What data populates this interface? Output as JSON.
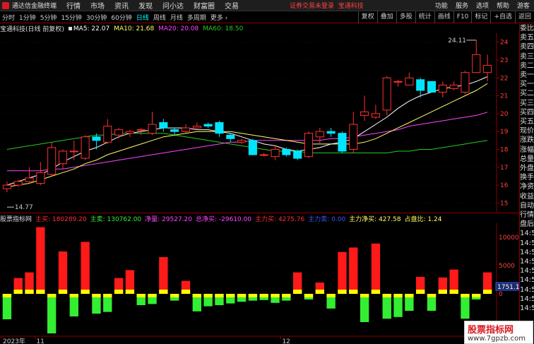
{
  "menu": {
    "app_title": "通达信金融终端",
    "items": [
      "行情",
      "市场",
      "资讯",
      "发现",
      "问小达",
      "财富圈",
      "交易"
    ],
    "notice": "证券交易未登录",
    "stock_name_top": "宝通科技",
    "right_items": [
      "功能",
      "服务",
      "选项",
      "帮助",
      "游客"
    ]
  },
  "toolbar": {
    "periods": [
      "分时",
      "1分钟",
      "5分钟",
      "15分钟",
      "30分钟",
      "60分钟",
      "日线",
      "周线",
      "月线",
      "多周期",
      "更多"
    ],
    "active": "日线",
    "right": [
      "复权",
      "叠加",
      "多股",
      "统计",
      "画线",
      "F10",
      "标记",
      "+自选",
      "返回"
    ]
  },
  "info": {
    "stock": "宝通科技(日线 前复权)",
    "ma5": "MA5: 22.07",
    "ma10": "MA10: 21.68",
    "ma20": "MA20: 20.08",
    "ma60": "MA60: 18.50"
  },
  "indicator": {
    "name": "股票指标网",
    "main_buy": "主买: 180289.20",
    "main_sell": "主卖: 130762.00",
    "net_buy": "净量: 29527.20",
    "total_net": "总净买: -29610.00",
    "main_force_buy": "主力买: 4275.76",
    "main_force_sell": "主力卖: 0.00",
    "main_force_net": "主力净买: 427.58",
    "ratio": "占盘比: 1.24"
  },
  "right_panel": [
    "委比",
    "卖五",
    "卖四",
    "卖三",
    "卖二",
    "卖一",
    "买一",
    "买二",
    "买三",
    "买四",
    "买五",
    "现价",
    "涨跌",
    "涨幅",
    "总量",
    "外盘",
    "换手",
    "净资",
    "收益",
    "自动",
    "行情",
    "盘后",
    "14:5",
    "14:5",
    "14:5",
    "14:5",
    "14:5",
    "14:5",
    "14:5",
    "14:5",
    "14:5"
  ],
  "watermark": {
    "title": "股票指标网",
    "url": "www.7gpzb.com"
  },
  "chart_data": [
    {
      "type": "candlestick",
      "yaxis": [
        24.0,
        23.0,
        22.0,
        21.0,
        20.0,
        19.0,
        18.0,
        17.0,
        16.0,
        15.0
      ],
      "ylim": [
        14.5,
        24.5
      ],
      "annotations": [
        {
          "label": "24.11",
          "value": 24.11
        },
        {
          "label": "14.77",
          "value": 14.77
        }
      ],
      "colors": {
        "up": "#ff3030",
        "down": "#00e5ff",
        "ma5": "#ffffff",
        "ma10": "#ffff66",
        "ma20": "#ff44ff",
        "ma60": "#22cc22"
      },
      "candles": [
        {
          "o": 15.8,
          "c": 16.0,
          "h": 16.2,
          "l": 15.6
        },
        {
          "o": 16.0,
          "c": 16.2,
          "h": 16.3,
          "l": 15.9
        },
        {
          "o": 16.2,
          "c": 16.4,
          "h": 17.0,
          "l": 16.1
        },
        {
          "o": 16.1,
          "c": 16.7,
          "h": 17.3,
          "l": 16.0
        },
        {
          "o": 16.6,
          "c": 18.1,
          "h": 18.4,
          "l": 16.5
        },
        {
          "o": 17.2,
          "c": 17.9,
          "h": 18.0,
          "l": 16.9
        },
        {
          "o": 17.9,
          "c": 17.9,
          "h": 18.5,
          "l": 17.4
        },
        {
          "o": 17.5,
          "c": 18.7,
          "h": 18.8,
          "l": 17.4
        },
        {
          "o": 18.7,
          "c": 18.5,
          "h": 18.9,
          "l": 18.0
        },
        {
          "o": 18.4,
          "c": 19.3,
          "h": 19.7,
          "l": 18.3
        },
        {
          "o": 18.8,
          "c": 19.1,
          "h": 19.2,
          "l": 18.6
        },
        {
          "o": 18.9,
          "c": 19.0,
          "h": 19.1,
          "l": 18.7
        },
        {
          "o": 19.1,
          "c": 19.1,
          "h": 19.2,
          "l": 18.8
        },
        {
          "o": 18.9,
          "c": 19.4,
          "h": 20.1,
          "l": 18.8
        },
        {
          "o": 19.5,
          "c": 19.2,
          "h": 19.7,
          "l": 19.0
        },
        {
          "o": 19.1,
          "c": 19.0,
          "h": 19.2,
          "l": 18.8
        },
        {
          "o": 19.0,
          "c": 19.2,
          "h": 19.4,
          "l": 18.9
        },
        {
          "o": 19.2,
          "c": 19.3,
          "h": 19.5,
          "l": 19.1
        },
        {
          "o": 19.4,
          "c": 19.3,
          "h": 19.5,
          "l": 19.2
        },
        {
          "o": 19.5,
          "c": 18.9,
          "h": 19.6,
          "l": 18.7
        },
        {
          "o": 18.8,
          "c": 18.6,
          "h": 18.9,
          "l": 18.4
        },
        {
          "o": 18.4,
          "c": 18.5,
          "h": 18.6,
          "l": 18.3
        },
        {
          "o": 18.5,
          "c": 17.7,
          "h": 18.6,
          "l": 17.7
        },
        {
          "o": 17.7,
          "c": 17.7,
          "h": 17.8,
          "l": 17.6
        },
        {
          "o": 17.6,
          "c": 18.0,
          "h": 18.2,
          "l": 17.4
        },
        {
          "o": 18.0,
          "c": 17.7,
          "h": 18.1,
          "l": 17.6
        },
        {
          "o": 17.9,
          "c": 17.5,
          "h": 18.0,
          "l": 17.4
        },
        {
          "o": 17.6,
          "c": 18.9,
          "h": 19.0,
          "l": 17.5
        },
        {
          "o": 18.7,
          "c": 19.0,
          "h": 19.2,
          "l": 18.3
        },
        {
          "o": 19.0,
          "c": 18.9,
          "h": 19.2,
          "l": 18.7
        },
        {
          "o": 18.9,
          "c": 17.9,
          "h": 19.0,
          "l": 17.8
        },
        {
          "o": 18.0,
          "c": 19.4,
          "h": 20.1,
          "l": 17.8
        },
        {
          "o": 19.9,
          "c": 20.1,
          "h": 21.0,
          "l": 19.6
        },
        {
          "o": 19.8,
          "c": 20.0,
          "h": 20.5,
          "l": 19.7
        },
        {
          "o": 20.2,
          "c": 22.0,
          "h": 22.1,
          "l": 19.9
        },
        {
          "o": 21.8,
          "c": 21.8,
          "h": 21.9,
          "l": 21.5
        },
        {
          "o": 21.6,
          "c": 22.0,
          "h": 22.3,
          "l": 21.6
        },
        {
          "o": 21.9,
          "c": 21.3,
          "h": 22.0,
          "l": 20.9
        },
        {
          "o": 21.8,
          "c": 21.2,
          "h": 21.7,
          "l": 21.2
        },
        {
          "o": 21.2,
          "c": 21.6,
          "h": 21.8,
          "l": 20.9
        },
        {
          "o": 21.4,
          "c": 21.6,
          "h": 21.8,
          "l": 21.3
        },
        {
          "o": 21.2,
          "c": 22.3,
          "h": 22.4,
          "l": 21.1
        },
        {
          "o": 22.3,
          "c": 23.3,
          "h": 24.11,
          "l": 22.3
        },
        {
          "o": 22.3,
          "c": 22.7,
          "h": 23.3,
          "l": 21.8
        }
      ],
      "ma5": [
        16.0,
        16.2,
        16.4,
        16.6,
        16.9,
        17.3,
        17.6,
        17.9,
        18.1,
        18.4,
        18.7,
        18.9,
        19.0,
        19.1,
        19.2,
        19.2,
        19.2,
        19.1,
        19.1,
        19.0,
        18.9,
        18.7,
        18.5,
        18.3,
        18.2,
        18.0,
        17.9,
        18.0,
        18.1,
        18.3,
        18.4,
        18.6,
        19.0,
        19.4,
        19.8,
        20.3,
        20.7,
        21.0,
        21.2,
        21.4,
        21.5,
        21.6,
        21.8,
        22.07
      ],
      "ma10": [
        15.9,
        16.0,
        16.1,
        16.3,
        16.5,
        16.7,
        16.9,
        17.2,
        17.4,
        17.7,
        17.9,
        18.1,
        18.3,
        18.5,
        18.7,
        18.8,
        18.9,
        19.0,
        19.0,
        19.0,
        19.0,
        18.9,
        18.8,
        18.7,
        18.6,
        18.5,
        18.4,
        18.3,
        18.3,
        18.3,
        18.3,
        18.3,
        18.4,
        18.6,
        18.9,
        19.2,
        19.5,
        19.8,
        20.1,
        20.4,
        20.7,
        21.0,
        21.3,
        21.68
      ],
      "ma20": [
        16.8,
        16.8,
        16.8,
        16.8,
        16.9,
        16.9,
        17.0,
        17.1,
        17.2,
        17.3,
        17.4,
        17.5,
        17.6,
        17.7,
        17.8,
        17.9,
        18.0,
        18.1,
        18.2,
        18.3,
        18.4,
        18.4,
        18.5,
        18.5,
        18.5,
        18.5,
        18.5,
        18.5,
        18.5,
        18.6,
        18.6,
        18.7,
        18.8,
        18.9,
        19.0,
        19.1,
        19.3,
        19.4,
        19.5,
        19.6,
        19.7,
        19.8,
        19.9,
        20.08
      ],
      "ma60": [
        18.0,
        18.1,
        18.2,
        18.3,
        18.4,
        18.5,
        18.6,
        18.7,
        18.8,
        18.8,
        18.9,
        18.9,
        18.9,
        18.9,
        18.9,
        18.8,
        18.7,
        18.6,
        18.5,
        18.4,
        18.3,
        18.2,
        18.1,
        18.0,
        17.9,
        17.9,
        17.9,
        17.8,
        17.8,
        17.8,
        17.8,
        17.8,
        17.8,
        17.8,
        17.8,
        17.9,
        17.9,
        18.0,
        18.0,
        18.1,
        18.2,
        18.3,
        18.4,
        18.5
      ]
    },
    {
      "type": "bar",
      "yaxis": [
        10000,
        5000,
        0
      ],
      "ylim": [
        -7500,
        12500
      ],
      "readout": "1751.17",
      "xlabels": [
        {
          "label": "2023年",
          "index": 0
        },
        {
          "label": "11",
          "index": 3
        },
        {
          "label": "12",
          "index": 25
        }
      ],
      "colors": {
        "pos": "#ff1a1a",
        "neg": "#33ee33",
        "cap": "#ffff00"
      },
      "values": [
        -4500,
        2800,
        3800,
        11800,
        -7000,
        7500,
        -4000,
        9200,
        -3500,
        -3200,
        2800,
        4200,
        -2000,
        -1800,
        6500,
        -1200,
        2300,
        -3100,
        -2200,
        -2000,
        -1700,
        -1400,
        -1200,
        -1100,
        -1600,
        -1200,
        3800,
        -1000,
        2000,
        -2600,
        7400,
        8200,
        -5000,
        8900,
        -4400,
        -4100,
        -3000,
        3000,
        -3000,
        2900,
        4300,
        -4400,
        -1000,
        3800
      ]
    }
  ]
}
